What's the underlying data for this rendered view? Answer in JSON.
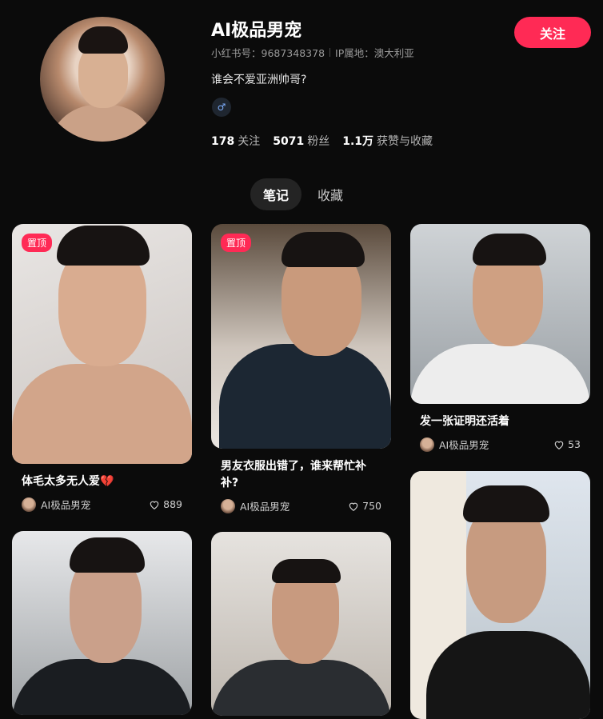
{
  "profile": {
    "name": "AI极品男宠",
    "id_label": "小红书号：9687348378",
    "ip_label": "IP属地：澳大利亚",
    "bio": "谁会不爱亚洲帅哥?",
    "gender_icon": "male-icon",
    "follow_button": "关注",
    "stats": [
      {
        "value": "178",
        "label": "关注"
      },
      {
        "value": "5071",
        "label": "粉丝"
      },
      {
        "value": "1.1万",
        "label": "获赞与收藏"
      }
    ]
  },
  "tabs": [
    {
      "label": "笔记",
      "active": true
    },
    {
      "label": "收藏",
      "active": false
    }
  ],
  "notes": [
    {
      "pinned_label": "置顶",
      "title": "体毛太多无人爱💔",
      "author": "AI极品男宠",
      "likes": "889"
    },
    {
      "pinned_label": "置顶",
      "title": "男友衣服出错了，谁来帮忙补补?",
      "author": "AI极品男宠",
      "likes": "750"
    },
    {
      "pinned_label": "",
      "title": "发一张证明还活着",
      "author": "AI极品男宠",
      "likes": "53"
    },
    {
      "pinned_label": "",
      "title": "",
      "author": "",
      "likes": ""
    },
    {
      "pinned_label": "",
      "title": "",
      "author": "",
      "likes": ""
    },
    {
      "pinned_label": "",
      "title": "",
      "author": "",
      "likes": ""
    }
  ],
  "colors": {
    "accent": "#ff2a55",
    "background": "#0b0b0b"
  }
}
